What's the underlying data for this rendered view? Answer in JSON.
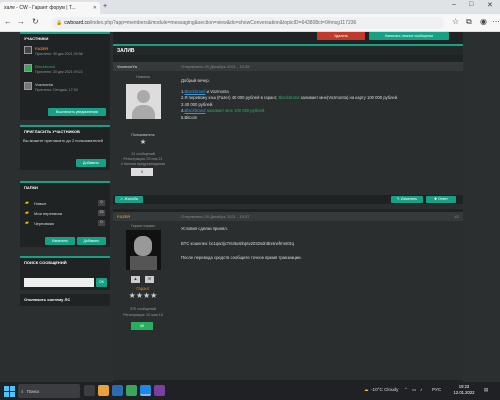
{
  "browser": {
    "tab_title": "хале - CW - Гарант форум | Т...",
    "url_domain": "cwboard.co",
    "url_path": "/index.php?app=members&module=messaging&section=view&do=showConversation&topicID=643808ct=0#msg117236"
  },
  "sidebar": {
    "participants": {
      "title": "УЧАСТНИКИ",
      "users": [
        {
          "name": "FAZER",
          "status": "Прочтено: 30 дек 2021 09:38"
        },
        {
          "name": "Blackbrand",
          "status": "Прочтено: 30 дек 2021 09:22"
        },
        {
          "name": "Vozmonta",
          "status": "Прочтено: Сегодня, 17:03"
        }
      ],
      "notify_btn": "Выключить уведомления"
    },
    "invite": {
      "title": "ПРИГЛАСИТЬ УЧАСТНИКОВ",
      "text": "Вы можете пригласить до 2 пользователей",
      "add_btn": "Добавить"
    },
    "folders": {
      "title": "ПАПКИ",
      "items": [
        {
          "label": "Новые",
          "count": "0"
        },
        {
          "label": "Мои переписки",
          "count": "23"
        },
        {
          "label": "Черновики",
          "count": "0"
        }
      ],
      "change_btn": "Изменить",
      "add_btn": "Добавить"
    },
    "search": {
      "title": "ПОИСК СООБЩЕНИЙ",
      "ok_btn": "OK"
    },
    "disable_btn": "Отключить систему ЛС"
  },
  "main": {
    "top_buttons": {
      "delete": "Удалить",
      "new_message": "Написать личное сообщение"
    },
    "section_title": "ЗАЛИВ",
    "posts": [
      {
        "author": "VozmonYa",
        "date": "Отправлено 29 Декабрь 2021 - 15:35",
        "user_title": "Новичок",
        "role": "Пользователь",
        "posts_count": "13 сообщений",
        "reg_date": "Регистрация: 29 ноя 21",
        "warns": "0 баллов предупреждения",
        "rep": "0",
        "greeting": "Добрый вечер.",
        "line1_num": "1.",
        "line1_user": "Blackbrand",
        "line1_rest": " и Vozmonta",
        "line2_pre": "2.Я перевожу кэш (Fazer) 40 000 рублей в гарант, ",
        "line2_user": "Blackbrand",
        "line2_post": " заливает мне(Vozmonta) на карту 100 000 рублей.",
        "line3": "3.40 000 рублей.",
        "line4_num": "4.",
        "line4_user": "Blackbrand",
        "line4_post": " заливает мне 100 000 рублей.",
        "line5": "5.Bitcoin",
        "complaint_btn": "Жалоба",
        "edit_btn": "Изменить",
        "reply_btn": "Ответ"
      },
      {
        "author": "FAZER",
        "date": "Отправлено 29 Декабрь 2021 - 15:37",
        "post_number": "#2",
        "user_title": "Гарант сервис",
        "role": "Гарант",
        "posts_count": "570 сообщений",
        "reg_date": "Регистрация: 20 мая 15",
        "rep": "40",
        "line1": "Условия сделки принял.",
        "line2": "BTC кошелек: bc1qw3jc7nt4tustlrq6v2032sdntbxsrwfrnrs0zq",
        "line3": "После перевода средств сообщите точное время транзакции."
      }
    ]
  },
  "taskbar": {
    "search_placeholder": "Поиск",
    "weather": "-10°C  Cloudy",
    "lang": "РУС",
    "time": "19:23",
    "date": "12.01.2022"
  },
  "colors": {
    "accent": "#16a085",
    "bg": "#2b2f30",
    "panel": "#1f2324",
    "green_text": "#27ae60",
    "danger": "#c0392b"
  }
}
